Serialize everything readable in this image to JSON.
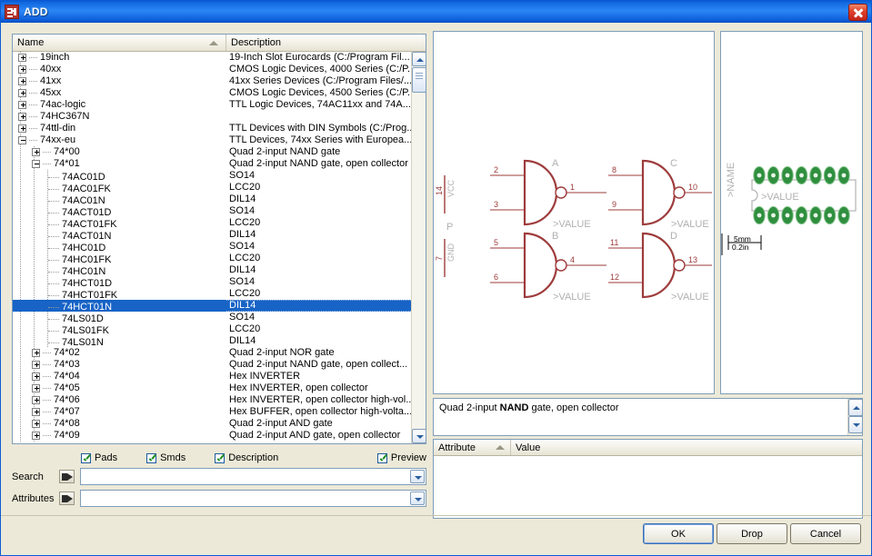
{
  "window": {
    "title": "ADD",
    "icon": "library-icon",
    "close_label": "×"
  },
  "tree": {
    "columns": {
      "name": "Name",
      "description": "Description"
    },
    "rows": [
      {
        "indent": 0,
        "toggle": "plus",
        "name": "19inch",
        "desc": "19-Inch Slot Eurocards (C:/Program Fil..."
      },
      {
        "indent": 0,
        "toggle": "plus",
        "name": "40xx",
        "desc": "CMOS Logic Devices, 4000 Series (C:/P..."
      },
      {
        "indent": 0,
        "toggle": "plus",
        "name": "41xx",
        "desc": "41xx Series Devices (C:/Program Files/..."
      },
      {
        "indent": 0,
        "toggle": "plus",
        "name": "45xx",
        "desc": "CMOS Logic Devices, 4500 Series (C:/P..."
      },
      {
        "indent": 0,
        "toggle": "plus",
        "name": "74ac-logic",
        "desc": "TTL Logic Devices, 74AC11xx and 74A..."
      },
      {
        "indent": 0,
        "toggle": "plus",
        "name": "74HC367N",
        "desc": ""
      },
      {
        "indent": 0,
        "toggle": "plus",
        "name": "74ttl-din",
        "desc": "TTL Devices with DIN Symbols (C:/Prog..."
      },
      {
        "indent": 0,
        "toggle": "minus",
        "name": "74xx-eu",
        "desc": "TTL Devices, 74xx Series with Europea..."
      },
      {
        "indent": 1,
        "toggle": "plus",
        "name": "74*00",
        "desc": "Quad 2-input NAND gate"
      },
      {
        "indent": 1,
        "toggle": "minus",
        "name": "74*01",
        "desc": "Quad 2-input NAND gate, open collector"
      },
      {
        "indent": 2,
        "toggle": "leaf",
        "name": "74AC01D",
        "desc": "SO14"
      },
      {
        "indent": 2,
        "toggle": "leaf",
        "name": "74AC01FK",
        "desc": "LCC20"
      },
      {
        "indent": 2,
        "toggle": "leaf",
        "name": "74AC01N",
        "desc": "DIL14"
      },
      {
        "indent": 2,
        "toggle": "leaf",
        "name": "74ACT01D",
        "desc": "SO14"
      },
      {
        "indent": 2,
        "toggle": "leaf",
        "name": "74ACT01FK",
        "desc": "LCC20"
      },
      {
        "indent": 2,
        "toggle": "leaf",
        "name": "74ACT01N",
        "desc": "DIL14"
      },
      {
        "indent": 2,
        "toggle": "leaf",
        "name": "74HC01D",
        "desc": "SO14"
      },
      {
        "indent": 2,
        "toggle": "leaf",
        "name": "74HC01FK",
        "desc": "LCC20"
      },
      {
        "indent": 2,
        "toggle": "leaf",
        "name": "74HC01N",
        "desc": "DIL14"
      },
      {
        "indent": 2,
        "toggle": "leaf",
        "name": "74HCT01D",
        "desc": "SO14"
      },
      {
        "indent": 2,
        "toggle": "leaf",
        "name": "74HCT01FK",
        "desc": "LCC20"
      },
      {
        "indent": 2,
        "toggle": "leaf",
        "name": "74HCT01N",
        "desc": "DIL14",
        "selected": true
      },
      {
        "indent": 2,
        "toggle": "leaf",
        "name": "74LS01D",
        "desc": "SO14"
      },
      {
        "indent": 2,
        "toggle": "leaf",
        "name": "74LS01FK",
        "desc": "LCC20"
      },
      {
        "indent": 2,
        "toggle": "leaf",
        "name": "74LS01N",
        "desc": "DIL14"
      },
      {
        "indent": 1,
        "toggle": "plus",
        "name": "74*02",
        "desc": "Quad 2-input NOR gate"
      },
      {
        "indent": 1,
        "toggle": "plus",
        "name": "74*03",
        "desc": "Quad 2-input NAND gate, open collect..."
      },
      {
        "indent": 1,
        "toggle": "plus",
        "name": "74*04",
        "desc": "Hex INVERTER"
      },
      {
        "indent": 1,
        "toggle": "plus",
        "name": "74*05",
        "desc": "Hex INVERTER, open collector"
      },
      {
        "indent": 1,
        "toggle": "plus",
        "name": "74*06",
        "desc": "Hex INVERTER, open collector high-vol..."
      },
      {
        "indent": 1,
        "toggle": "plus",
        "name": "74*07",
        "desc": "Hex BUFFER, open collector high-volta..."
      },
      {
        "indent": 1,
        "toggle": "plus",
        "name": "74*08",
        "desc": "Quad 2-input AND gate"
      },
      {
        "indent": 1,
        "toggle": "plus",
        "name": "74*09",
        "desc": "Quad 2-input AND gate, open collector"
      }
    ]
  },
  "symbol_preview": {
    "power": {
      "pin_vcc": "14",
      "label_vcc": "VCC",
      "name": "P",
      "pin_gnd": "7",
      "label_gnd": "GND"
    },
    "gates": [
      {
        "name": "A",
        "in1": "2",
        "in2": "3",
        "out": "1",
        "value": ">VALUE"
      },
      {
        "name": "C",
        "in1": "8",
        "in2": "9",
        "out": "10",
        "value": ">VALUE"
      },
      {
        "name": "B",
        "in1": "5",
        "in2": "6",
        "out": "4",
        "value": ">VALUE"
      },
      {
        "name": "D",
        "in1": "11",
        "in2": "12",
        "out": "13",
        "value": ">VALUE"
      }
    ]
  },
  "package_preview": {
    "name_label": ">NAME",
    "value_label": ">VALUE",
    "pad_count": 14,
    "scale_mm": "5mm",
    "scale_in": "0.2in"
  },
  "description": {
    "prefix": "Quad 2-input ",
    "bold": "NAND",
    "suffix": " gate, open collector"
  },
  "attributes": {
    "columns": {
      "attribute": "Attribute",
      "value": "Value"
    },
    "rows": []
  },
  "options": [
    {
      "label": "Pads",
      "checked": true
    },
    {
      "label": "Smds",
      "checked": true
    },
    {
      "label": "Description",
      "checked": true
    },
    {
      "label": "Preview",
      "checked": true
    }
  ],
  "search": {
    "label": "Search",
    "value": "",
    "placeholder": ""
  },
  "attributes_field": {
    "label": "Attributes",
    "value": "",
    "placeholder": ""
  },
  "buttons": {
    "ok": "OK",
    "drop": "Drop",
    "cancel": "Cancel"
  },
  "colors": {
    "titlebar": "#2b87f5",
    "selection": "#1763c6",
    "schematic": "#9e3b3b",
    "pad_green": "#2f8f3f",
    "dialog_face": "#ece9d8"
  }
}
